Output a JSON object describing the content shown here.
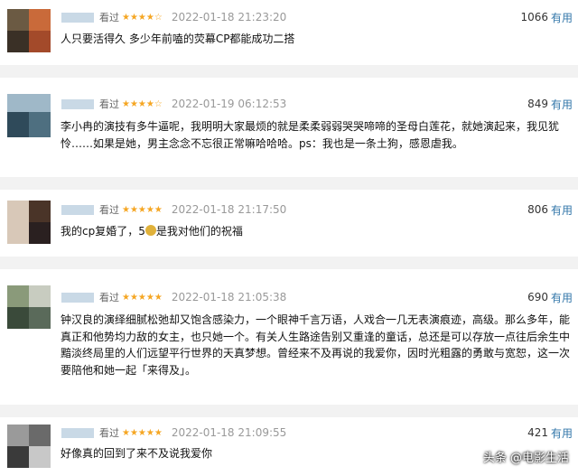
{
  "reviews": [
    {
      "seen_label": "看过",
      "stars": "★★★★☆",
      "time": "2022-01-18 21:23:20",
      "useful_count": "1066",
      "useful_label": "有用",
      "text": "人只要活得久 多少年前嗑的荧幕CP都能成功二搭",
      "avatar_colors": [
        "#6b5a43",
        "#c96a3a",
        "#3a3026",
        "#a34a2a"
      ]
    },
    {
      "seen_label": "看过",
      "stars": "★★★★☆",
      "time": "2022-01-19 06:12:53",
      "useful_count": "849",
      "useful_label": "有用",
      "text": "李小冉的演技有多牛逼呢，我明明大家最烦的就是柔柔弱弱哭哭啼啼的圣母白莲花，就她演起来，我见犹怜……如果是她，男主念念不忘很正常嘛哈哈哈。ps：我也是一条土狗，感恩虐我。",
      "avatar_colors": [
        "#9fb8c8",
        "#2f4a5a",
        "#c8d4dc",
        "#4e6f80"
      ]
    },
    {
      "seen_label": "看过",
      "stars": "★★★★★",
      "time": "2022-01-18 21:17:50",
      "useful_count": "806",
      "useful_label": "有用",
      "text_before": "我的cp复婚了，5",
      "text_after": "是我对他们的祝福",
      "avatar_colors": [
        "#d8c8b8",
        "#4a3428",
        "#b89888",
        "#2a2020"
      ]
    },
    {
      "seen_label": "看过",
      "stars": "★★★★★",
      "time": "2022-01-18 21:05:38",
      "useful_count": "690",
      "useful_label": "有用",
      "text": "钟汉良的演绎细腻松弛却又饱含感染力，一个眼神千言万语，人戏合一几无表演痕迹，高级。那么多年，能真正和他势均力敌的女主，也只她一个。有关人生路途告别又重逢的童话，总还是可以存放一点往后余生中黯淡终局里的人们远望平行世界的天真梦想。曾经来不及再说的我爱你，因时光粗露的勇敢与宽恕，这一次要陪他和她一起「来得及」。",
      "avatar_colors": [
        "#8a9a7a",
        "#3a4a3a",
        "#c8ccc0",
        "#5a6a5a"
      ]
    },
    {
      "seen_label": "看过",
      "stars": "★★★★★",
      "time": "2022-01-18 21:09:55",
      "useful_count": "421",
      "useful_label": "有用",
      "text": "好像真的回到了来不及说我爱你",
      "avatar_colors": [
        "#9a9a9a",
        "#3a3a3a",
        "#6a6a6a",
        "#c8c8c8"
      ]
    }
  ],
  "watermark": "头条 @电影生活"
}
